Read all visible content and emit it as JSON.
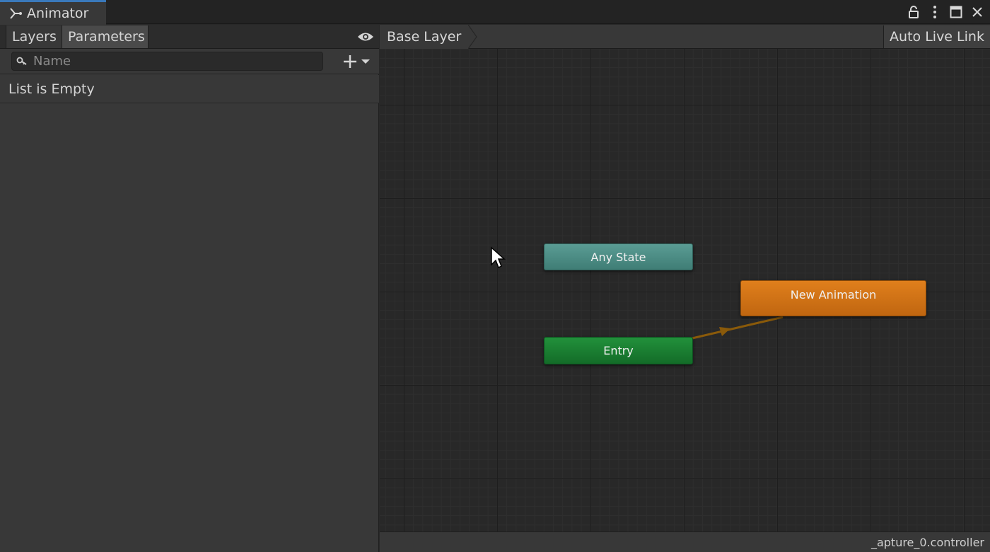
{
  "window": {
    "tab_title": "Animator",
    "tab_icon": "animator-icon",
    "controls": [
      "lock-icon",
      "kebab-menu-icon",
      "maximize-icon",
      "close-icon"
    ]
  },
  "left_panel": {
    "tabs": [
      {
        "label": "Layers",
        "active": false
      },
      {
        "label": "Parameters",
        "active": true
      }
    ],
    "visibility_icon": "eye-icon",
    "search": {
      "placeholder": "Name",
      "value": ""
    },
    "add_icon": "plus-dropdown-icon",
    "empty_message": "List is Empty"
  },
  "graph": {
    "breadcrumb": [
      "Base Layer"
    ],
    "auto_live_link_label": "Auto Live Link",
    "nodes": {
      "any_state": "Any State",
      "entry": "Entry",
      "default_state": "New Animation"
    },
    "transition_color": "#8a5a0a",
    "status_text": "_apture_0.controller"
  },
  "colors": {
    "tab_accent": "#3a79bb",
    "any_state": "#4a8d85",
    "entry": "#1a8033",
    "default_state": "#d27317"
  }
}
